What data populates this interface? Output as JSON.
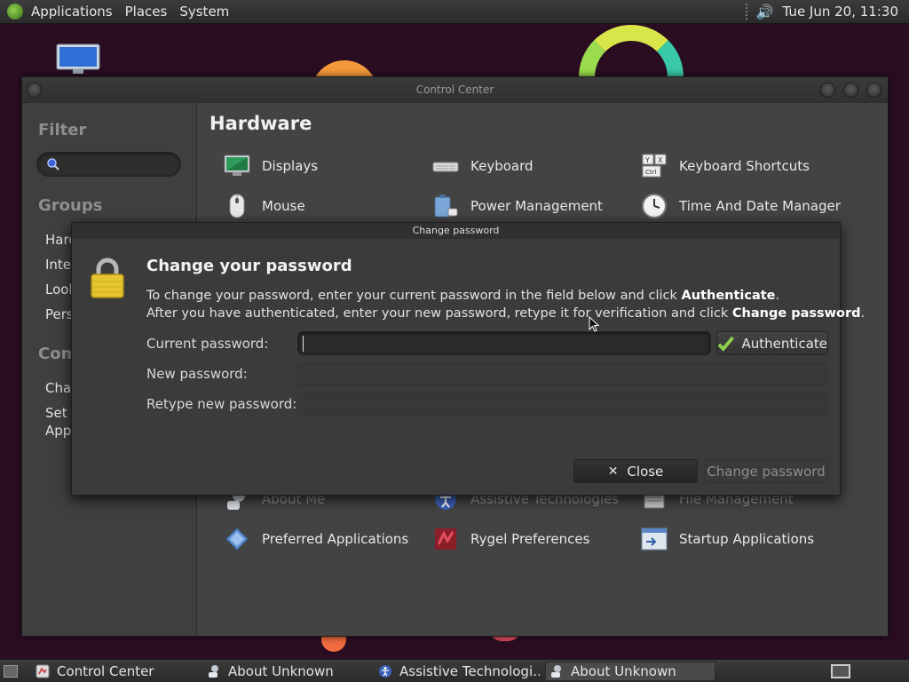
{
  "top_panel": {
    "menus": [
      "Applications",
      "Places",
      "System"
    ],
    "clock": "Tue Jun 20, 11:30"
  },
  "control_center": {
    "window_title": "Control Center",
    "sidebar": {
      "filter_heading": "Filter",
      "filter_placeholder": "",
      "groups_heading": "Groups",
      "group_items": [
        "Hard",
        "Inter",
        "Look",
        "Pers"
      ],
      "common_heading": "Com",
      "common_items": [
        "Char",
        "Set I",
        "Appl"
      ]
    },
    "section_title": "Hardware",
    "items": [
      {
        "label": "Displays",
        "icon": "monitor-icon"
      },
      {
        "label": "Keyboard",
        "icon": "keyboard-icon"
      },
      {
        "label": "Keyboard Shortcuts",
        "icon": "keyboard-shortcuts-icon"
      },
      {
        "label": "Mouse",
        "icon": "mouse-icon"
      },
      {
        "label": "Power Management",
        "icon": "power-icon"
      },
      {
        "label": "Time And Date Manager",
        "icon": "clock-icon"
      },
      {
        "label": "About Me",
        "icon": "about-me-icon"
      },
      {
        "label": "Assistive Technologies",
        "icon": "accessibility-icon"
      },
      {
        "label": "File Management",
        "icon": "file-management-icon"
      },
      {
        "label": "Preferred Applications",
        "icon": "preferred-apps-icon"
      },
      {
        "label": "Rygel Preferences",
        "icon": "rygel-icon"
      },
      {
        "label": "Startup Applications",
        "icon": "startup-apps-icon"
      }
    ]
  },
  "dialog": {
    "title": "Change password",
    "heading": "Change your password",
    "line1_pre": "To change your password, enter your current password in the field below and click ",
    "line1_bold": "Authenticate",
    "line1_post": ".",
    "line2_pre": "After you have authenticated, enter your new password, retype it for verification and click ",
    "line2_bold": "Change password",
    "line2_post": ".",
    "current_label": "Current password:",
    "new_label": "New password:",
    "retype_label": "Retype new password:",
    "current_value": "",
    "new_value": "",
    "retype_value": "",
    "authenticate_label": "Authenticate",
    "close_label": "Close",
    "change_label": "Change password"
  },
  "taskbar": {
    "tasks": [
      {
        "label": "Control Center",
        "icon": "control-center-icon"
      },
      {
        "label": "About Unknown",
        "icon": "user-icon"
      },
      {
        "label": "Assistive Technologi…",
        "icon": "accessibility-icon"
      },
      {
        "label": "About Unknown",
        "icon": "user-icon"
      }
    ]
  },
  "colors": {
    "accent_check": "#8fd14f",
    "lock_gold": "#e6c531"
  }
}
